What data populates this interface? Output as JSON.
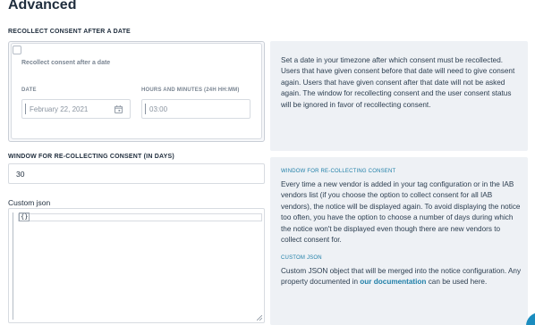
{
  "page": {
    "title": "Advanced"
  },
  "recollect": {
    "section_label": "RECOLLECT CONSENT AFTER A DATE",
    "checkbox_label": "Recollect consent after a date",
    "date_label": "DATE",
    "date_placeholder": "February 22, 2021",
    "time_label": "HOURS AND MINUTES (24H HH:MM)",
    "time_placeholder": "03:00",
    "help": "Set a date in your timezone after which consent must be recollected. Users that have given consent before that date will need to give consent again. Users that have given consent after that date will not be asked again. The window for recollecting consent and the user consent status will be ignored in favor of recollecting consent."
  },
  "window": {
    "section_label": "WINDOW FOR RE-COLLECTING CONSENT (IN DAYS)",
    "value": "30",
    "help_heading": "WINDOW FOR RE-COLLECTING CONSENT",
    "help": "Every time a new vendor is added in your tag configuration or in the IAB vendors list (if you choose the option to collect consent for all IAB vendors), the notice will be displayed again. To avoid displaying the notice too often, you have the option to choose a number of days during which the notice won't be displayed even though there are new vendors to collect consent for."
  },
  "custom_json": {
    "label": "Custom json",
    "value": "{}",
    "help_heading": "CUSTOM JSON",
    "help_before": "Custom JSON object that will be merged into the notice configuration. Any property documented in ",
    "link_text": "our documentation",
    "help_after": " can be used here."
  },
  "icons": {
    "calendar": "calendar-icon",
    "resize": "resize-handle-icon",
    "help": "help-bubble-icon"
  },
  "colors": {
    "accent": "#1f7fa8",
    "panel": "#eef1f5",
    "bubble": "#1a8cbf"
  }
}
